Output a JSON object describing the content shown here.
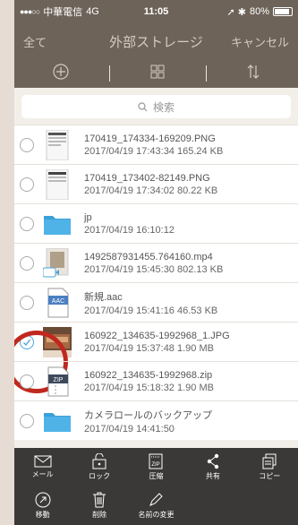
{
  "status": {
    "carrier": "中華電信",
    "network": "4G",
    "time": "11:05",
    "battery": "80%"
  },
  "header": {
    "back_label": "全て",
    "title": "外部ストレージ",
    "cancel_label": "キャンセル"
  },
  "search": {
    "placeholder": "検索"
  },
  "files": [
    {
      "name": "170419_174334-169209.PNG",
      "meta": "2017/04/19 17:43:34  165.24 KB",
      "type": "image",
      "selected": false
    },
    {
      "name": "170419_173402-82149.PNG",
      "meta": "2017/04/19 17:34:02  80.22 KB",
      "type": "image",
      "selected": false
    },
    {
      "name": "jp",
      "meta": "2017/04/19 16:10:12",
      "type": "folder",
      "selected": false
    },
    {
      "name": "1492587931455.764160.mp4",
      "meta": "2017/04/19 15:45:30  802.13 KB",
      "type": "video",
      "selected": false
    },
    {
      "name": "新規.aac",
      "meta": "2017/04/19 15:41:16  46.53 KB",
      "type": "aac",
      "selected": false
    },
    {
      "name": "160922_134635-1992968_1.JPG",
      "meta": "2017/04/19 15:37:48  1.90 MB",
      "type": "photo",
      "selected": true
    },
    {
      "name": "160922_134635-1992968.zip",
      "meta": "2017/04/19 15:18:32  1.90 MB",
      "type": "zip",
      "selected": false
    },
    {
      "name": "カメラロールのバックアップ",
      "meta": "2017/04/19 14:41:50",
      "type": "folder",
      "selected": false
    }
  ],
  "actions": {
    "mail": "メール",
    "lock": "ロック",
    "compress": "圧縮",
    "share": "共有",
    "copy": "コピー",
    "move": "移動",
    "delete": "削除",
    "rename": "名前の変更"
  },
  "icons": {
    "add": "plus-circle-icon",
    "grid": "grid-icon",
    "sort": "sort-arrows-icon",
    "search": "search-icon",
    "mail": "mail-icon",
    "lock": "lock-icon",
    "zip": "zip-icon",
    "share": "share-icon",
    "copy": "copy-icon",
    "move": "move-icon",
    "delete": "trash-icon",
    "rename": "pen-icon"
  },
  "colors": {
    "bar": "#6e6359",
    "accent": "#4aa3d9",
    "highlight": "#c0281f",
    "action_bar": "#3b3838"
  }
}
